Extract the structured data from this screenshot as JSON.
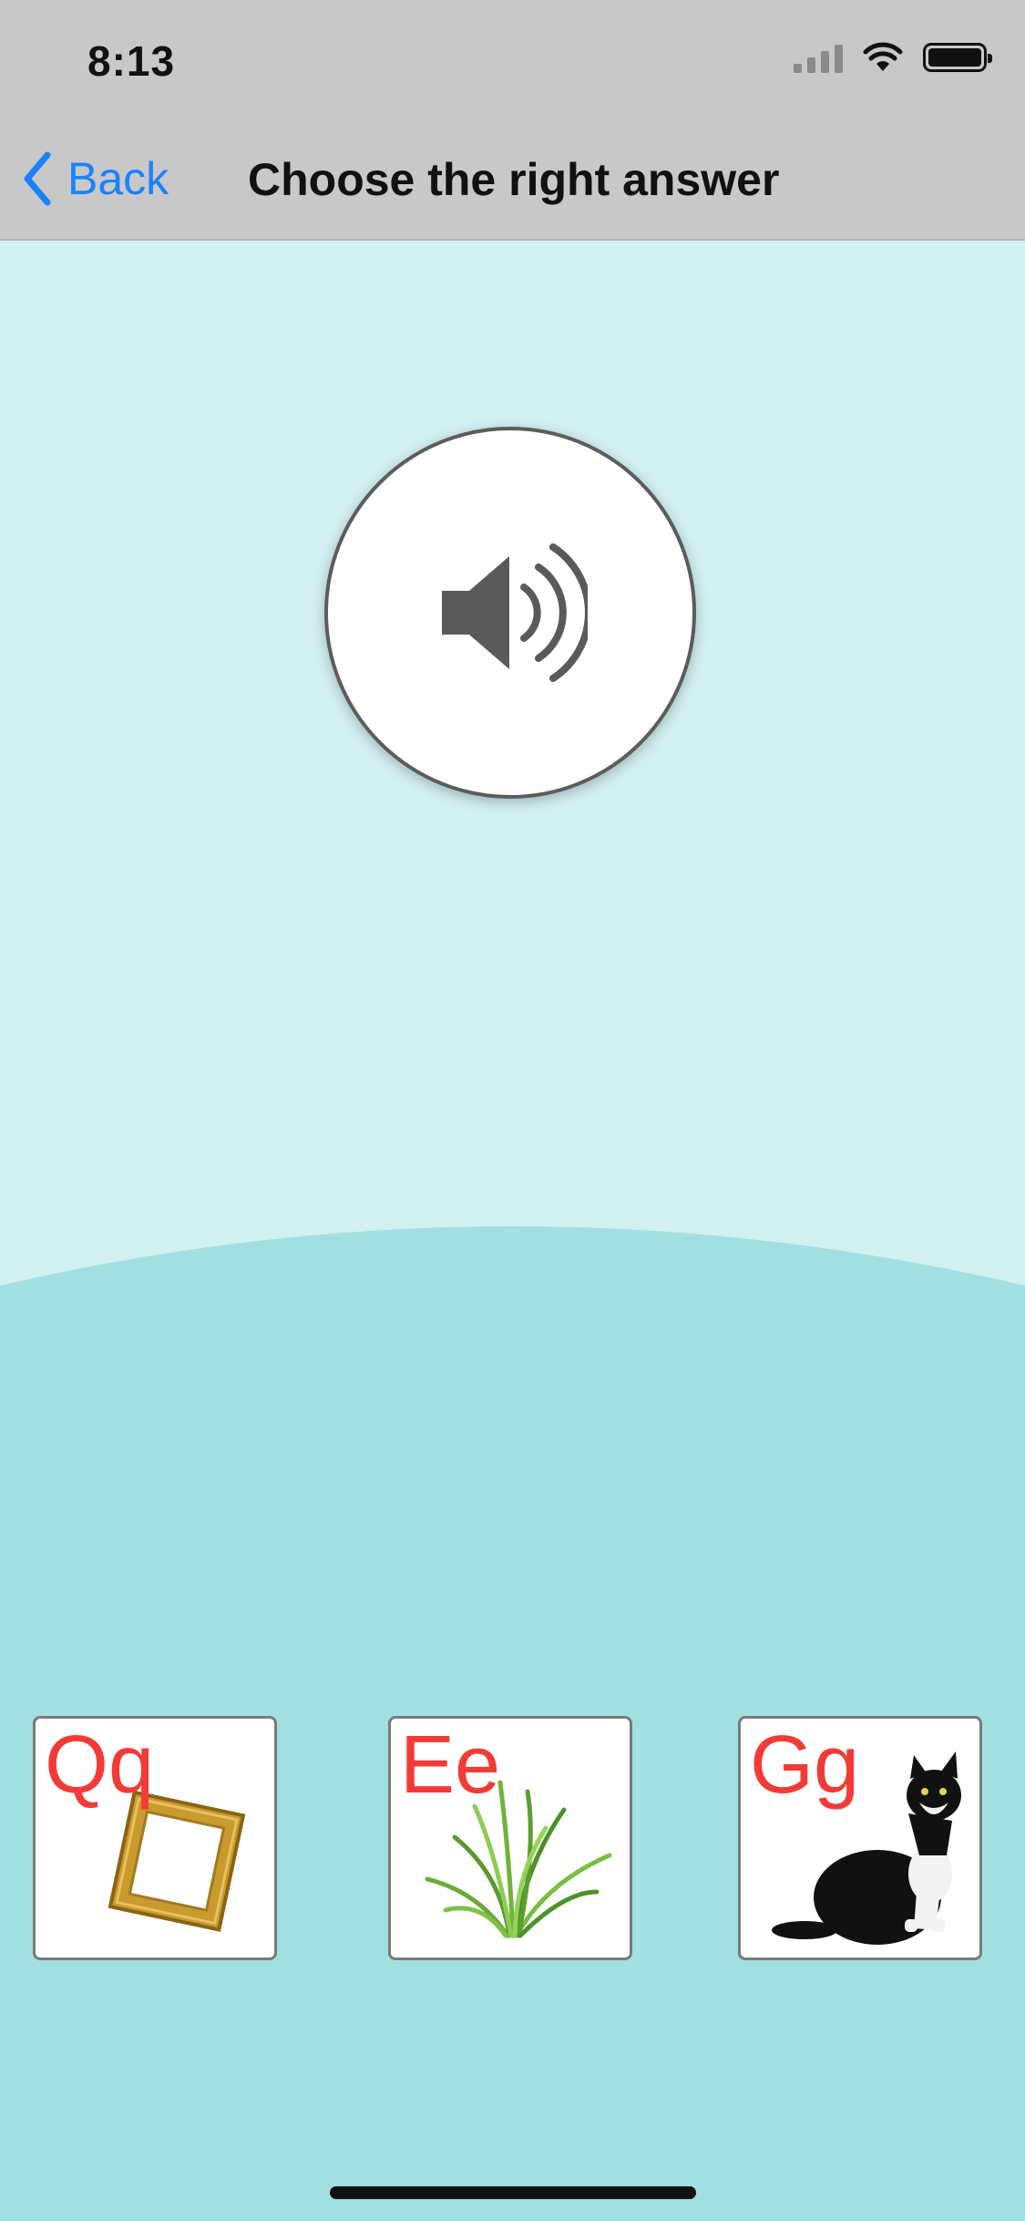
{
  "status_bar": {
    "time": "8:13",
    "signal_icon": "cellular-signal-icon",
    "wifi_icon": "wifi-icon",
    "battery_icon": "battery-icon"
  },
  "nav": {
    "back_label": "Back",
    "back_icon": "chevron-left-icon",
    "title": "Choose the right answer"
  },
  "speaker": {
    "icon": "speaker-volume-icon"
  },
  "answers": [
    {
      "letter": "Qq",
      "picture": "picture-frame-image"
    },
    {
      "letter": "Ee",
      "picture": "grass-image"
    },
    {
      "letter": "Gg",
      "picture": "cat-image"
    }
  ],
  "colors": {
    "accent": "#1a82ff",
    "letter": "#f23b36",
    "sky": "#d2f0f1",
    "ground": "#a2dfe0",
    "bar": "#c8c8c8"
  }
}
